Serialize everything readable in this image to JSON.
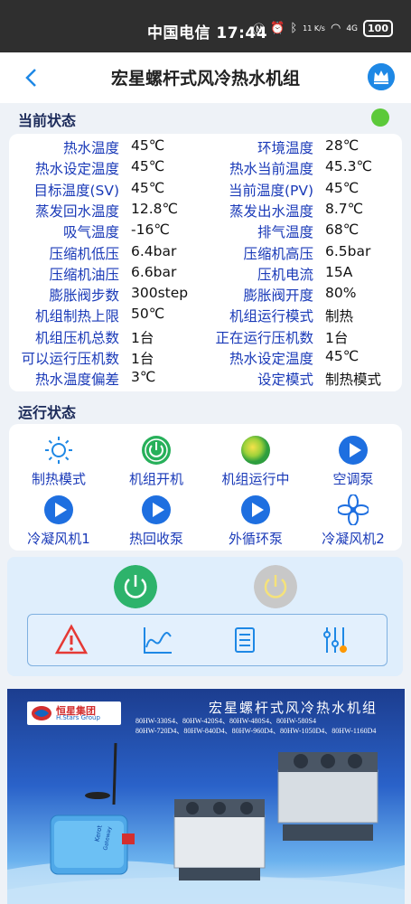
{
  "statusbar": {
    "carrier": "中国电信",
    "time": "17:44",
    "net_speed": "11 K/s",
    "signal": "4G",
    "battery": "100"
  },
  "header": {
    "title": "宏星螺杆式风冷热水机组"
  },
  "current_status": {
    "heading": "当前状态",
    "rows": [
      {
        "k1": "热水温度",
        "v1": "45℃",
        "k2": "环境温度",
        "v2": "28℃"
      },
      {
        "k1": "热水设定温度",
        "v1": "45℃",
        "k2": "热水当前温度",
        "v2": "45.3℃"
      },
      {
        "k1": "目标温度(SV)",
        "v1": "45℃",
        "k2": "当前温度(PV)",
        "v2": "45℃"
      },
      {
        "k1": "蒸发回水温度",
        "v1": "12.8℃",
        "k2": "蒸发出水温度",
        "v2": "8.7℃"
      },
      {
        "k1": "吸气温度",
        "v1": "-16℃",
        "k2": "排气温度",
        "v2": "68℃"
      },
      {
        "k1": "压缩机低压",
        "v1": "6.4bar",
        "k2": "压缩机高压",
        "v2": "6.5bar"
      },
      {
        "k1": "压缩机油压",
        "v1": "6.6bar",
        "k2": "压机电流",
        "v2": "15A"
      },
      {
        "k1": "膨胀阀步数",
        "v1": "300step",
        "k2": "膨胀阀开度",
        "v2": "80%"
      },
      {
        "k1": "机组制热上限",
        "v1": "50℃",
        "k2": "机组运行模式",
        "v2": "制热"
      },
      {
        "k1": "机组压机总数",
        "v1": "1台",
        "k2": "正在运行压机数",
        "v2": "1台"
      },
      {
        "k1": "可以运行压机数",
        "v1": "1台",
        "k2": "热水设定温度",
        "v2": "45℃"
      },
      {
        "k1": "热水温度偏差",
        "v1": "3℃",
        "k2": "设定模式",
        "v2": "制热模式"
      }
    ]
  },
  "run_status": {
    "heading": "运行状态",
    "items": [
      {
        "label": "制热模式",
        "icon": "sun-icon"
      },
      {
        "label": "机组开机",
        "icon": "power-on-icon"
      },
      {
        "label": "机组运行中",
        "icon": "running-ball-icon"
      },
      {
        "label": "空调泵",
        "icon": "play-icon"
      },
      {
        "label": "冷凝风机1",
        "icon": "play-icon"
      },
      {
        "label": "热回收泵",
        "icon": "play-icon"
      },
      {
        "label": "外循环泵",
        "icon": "play-icon"
      },
      {
        "label": "冷凝风机2",
        "icon": "fan-icon"
      }
    ]
  },
  "controls": {
    "power_on_color": "#2db36b",
    "power_off_color": "#c8c8c8"
  },
  "banner": {
    "logo_cn": "恒星集团",
    "logo_en": "H.Stars Group",
    "title": "宏星螺杆式风冷热水机组",
    "models_line1": "80HW-330S4、80HW-420S4、80HW-480S4、80HW-580S4",
    "models_line2": "80HW-720D4、80HW-840D4、80HW-960D4、80HW-1050D4、80HW-1160D4",
    "gateway_brand": "Kerot",
    "gateway_label": "Gateway"
  }
}
